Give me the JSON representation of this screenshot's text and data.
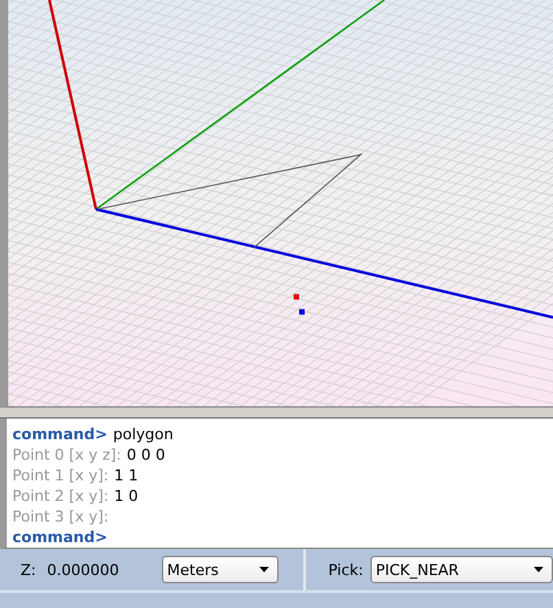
{
  "console": {
    "lines": [
      {
        "kind": "command",
        "prompt": "command>",
        "text": "polygon"
      },
      {
        "kind": "input",
        "prompt": "Point 0 [x y z]:",
        "text": "0 0 0"
      },
      {
        "kind": "input",
        "prompt": "Point 1 [x y]:",
        "text": "1 1"
      },
      {
        "kind": "input",
        "prompt": "Point 2 [x y]:",
        "text": "1 0"
      },
      {
        "kind": "input",
        "prompt": "Point 3 [x y]:"
      },
      {
        "kind": "command",
        "prompt": "command>"
      }
    ]
  },
  "status_bar": {
    "z_label": "Z:",
    "z_value": "0.000000",
    "units": "Meters",
    "pick_label": "Pick:",
    "pick_mode": "PICK_NEAR"
  }
}
